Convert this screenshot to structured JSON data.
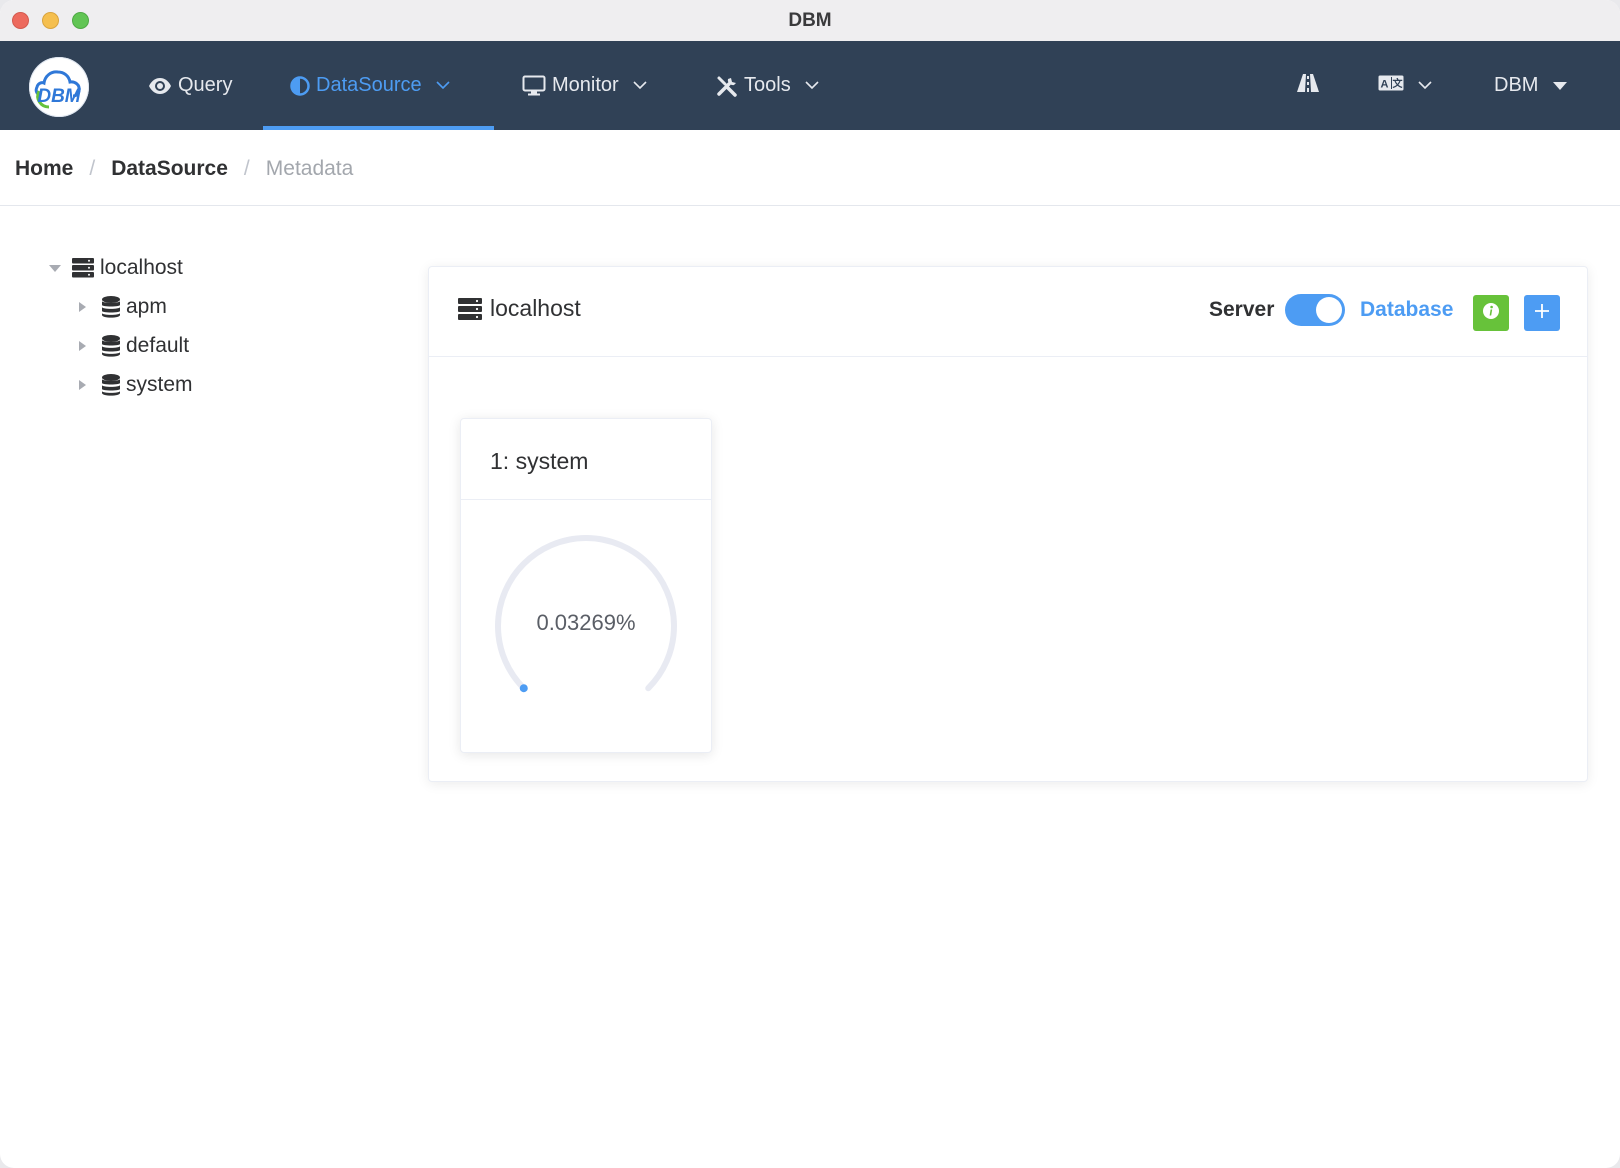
{
  "window": {
    "title": "DBM"
  },
  "nav": {
    "logo_text": "DBM",
    "items": [
      {
        "label": "Query",
        "icon": "eye-icon",
        "has_dropdown": false,
        "active": false
      },
      {
        "label": "DataSource",
        "icon": "half-circle-icon",
        "has_dropdown": true,
        "active": true
      },
      {
        "label": "Monitor",
        "icon": "monitor-icon",
        "has_dropdown": true,
        "active": false
      },
      {
        "label": "Tools",
        "icon": "tools-icon",
        "has_dropdown": true,
        "active": false
      }
    ],
    "right": {
      "road_icon": "road-icon",
      "language_icon": "translate-icon",
      "user_label": "DBM"
    },
    "colors": {
      "background": "#304156",
      "active": "#4d9cf3",
      "text": "#e6e9ee"
    }
  },
  "breadcrumb": [
    {
      "label": "Home"
    },
    {
      "label": "DataSource"
    },
    {
      "label": "Metadata"
    }
  ],
  "tree": {
    "root": {
      "label": "localhost",
      "icon": "server-icon",
      "expanded": true
    },
    "children": [
      {
        "label": "apm",
        "icon": "database-icon"
      },
      {
        "label": "default",
        "icon": "database-icon"
      },
      {
        "label": "system",
        "icon": "database-icon"
      }
    ]
  },
  "panel": {
    "title": "localhost",
    "switch": {
      "left_label": "Server",
      "right_label": "Database",
      "on": true
    },
    "buttons": {
      "info_icon": "info-icon",
      "add_icon": "plus-icon"
    },
    "colors": {
      "info": "#67c23a",
      "primary": "#4d9cf3"
    },
    "databases": [
      {
        "title": "1: system",
        "percentage_label": "0.03269%",
        "percentage": 0.03269
      }
    ]
  }
}
